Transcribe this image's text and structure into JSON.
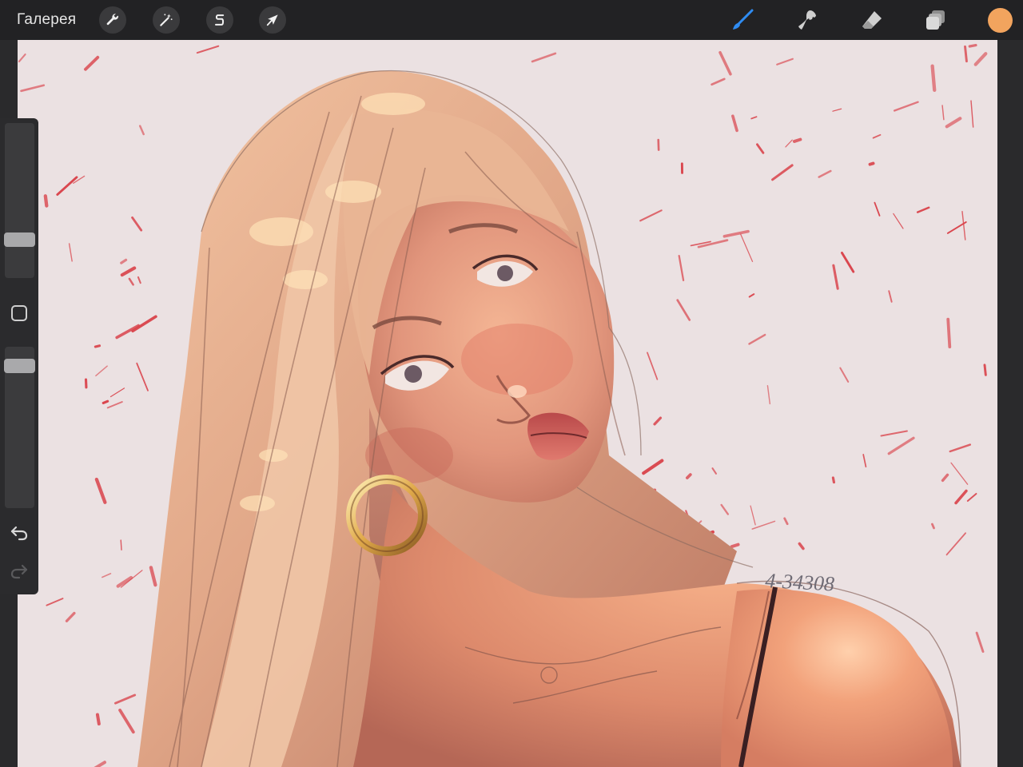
{
  "app": {
    "gallery_label": "Галерея"
  },
  "toolbar": {
    "left_tools": [
      {
        "name": "actions",
        "icon": "wrench-icon"
      },
      {
        "name": "adjustments",
        "icon": "magic-wand-icon"
      },
      {
        "name": "selection",
        "icon": "selection-s-icon"
      },
      {
        "name": "transform",
        "icon": "arrow-cursor-icon"
      }
    ],
    "right_tools": [
      {
        "name": "brush",
        "icon": "brush-icon",
        "active": true
      },
      {
        "name": "smudge",
        "icon": "smudge-icon"
      },
      {
        "name": "eraser",
        "icon": "eraser-icon"
      },
      {
        "name": "layers",
        "icon": "layers-icon"
      }
    ],
    "active_color": "#f2a45e",
    "accent_color": "#2f8cf2"
  },
  "sidebar": {
    "brush_size_level": 0.22,
    "opacity_level": 0.92,
    "modify_icon": "square-icon",
    "undo_icon": "undo-arrow-icon",
    "redo_icon": "redo-arrow-icon",
    "redo_enabled": false
  },
  "canvas": {
    "background_color": "#ebe1e2",
    "splatter_color": "#d9424a",
    "artwork": "portrait-painting",
    "signature": "4-34308"
  }
}
